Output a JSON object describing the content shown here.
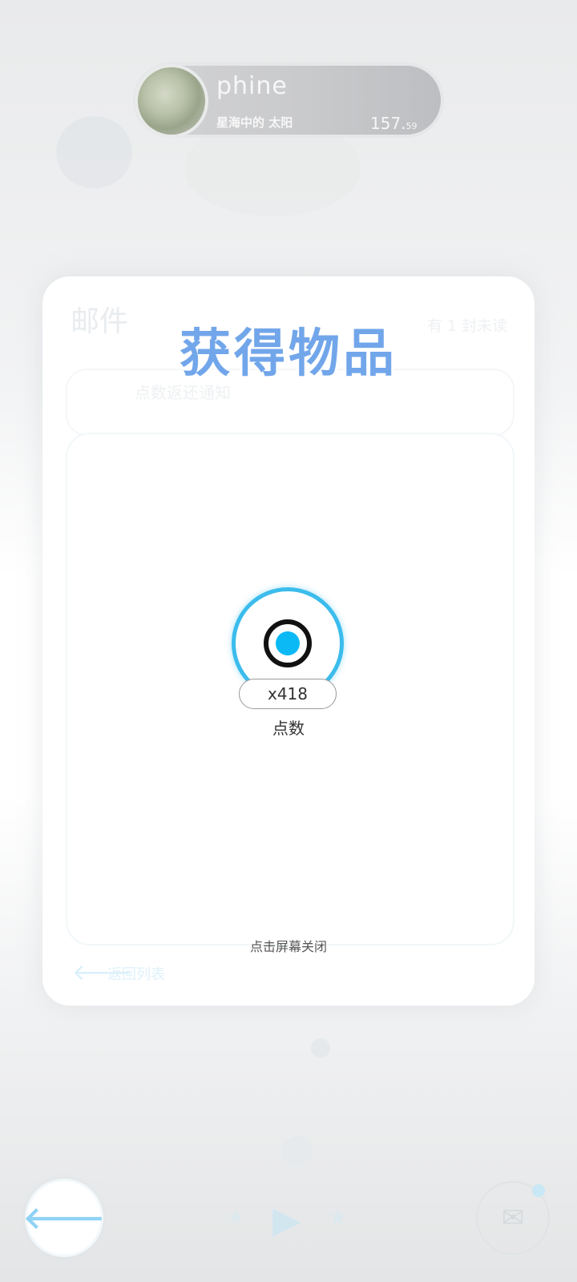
{
  "player": {
    "name": "phine",
    "title": "星海中的 太阳",
    "score_main": "157.",
    "score_decimal": "59"
  },
  "mail": {
    "heading": "邮件",
    "unread_status": "有 1 封未读",
    "item_title": "点数返还通知",
    "back_to_list": "返回列表"
  },
  "popup": {
    "title": "获得物品",
    "reward": {
      "icon": "points-icon",
      "count": "x418",
      "name": "点数"
    },
    "dismiss_hint": "点击屏幕关闭"
  },
  "colors": {
    "accent_blue": "#72a6ea",
    "ring_blue": "#3bbcec",
    "icon_blue": "#0bb9f5"
  }
}
